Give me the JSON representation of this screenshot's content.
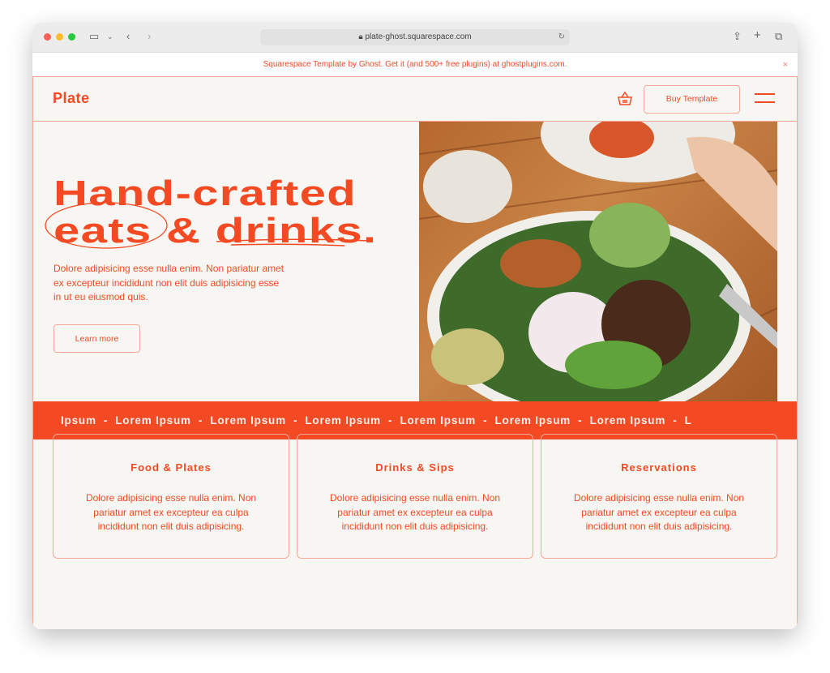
{
  "browser": {
    "url": "plate-ghost.squarespace.com"
  },
  "banner": {
    "text": "Squarespace Template by Ghost. Get it (and 500+ free plugins) at ghostplugins.com.",
    "close": "×"
  },
  "header": {
    "logo": "Plate",
    "buy_label": "Buy Template"
  },
  "hero": {
    "line1": "Hand-crafted",
    "word_eats": "eats",
    "amp": "&",
    "word_drinks": "drinks.",
    "lead": "Dolore adipisicing esse nulla enim. Non pariatur amet ex excepteur incididunt non elit duis adipisicing esse in ut eu eiusmod quis.",
    "cta": "Learn more"
  },
  "ribbon": {
    "text": "Ipsum  -  Lorem Ipsum  -  Lorem Ipsum  -  Lorem Ipsum  -  Lorem Ipsum  -  Lorem Ipsum  -  Lorem Ipsum  -  L"
  },
  "cards": [
    {
      "title": "Food & Plates",
      "text": "Dolore adipisicing esse nulla enim. Non pariatur amet ex excepteur ea culpa incididunt non elit duis adipisicing."
    },
    {
      "title": "Drinks & Sips",
      "text": "Dolore adipisicing esse nulla enim. Non pariatur amet ex excepteur ea culpa incididunt non elit duis adipisicing."
    },
    {
      "title": "Reservations",
      "text": "Dolore adipisicing esse nulla enim. Non pariatur amet ex excepteur ea culpa incididunt non elit duis adipisicing."
    }
  ],
  "colors": {
    "accent": "#f34a24",
    "background": "#f8f6f2",
    "border": "#f5a898"
  }
}
